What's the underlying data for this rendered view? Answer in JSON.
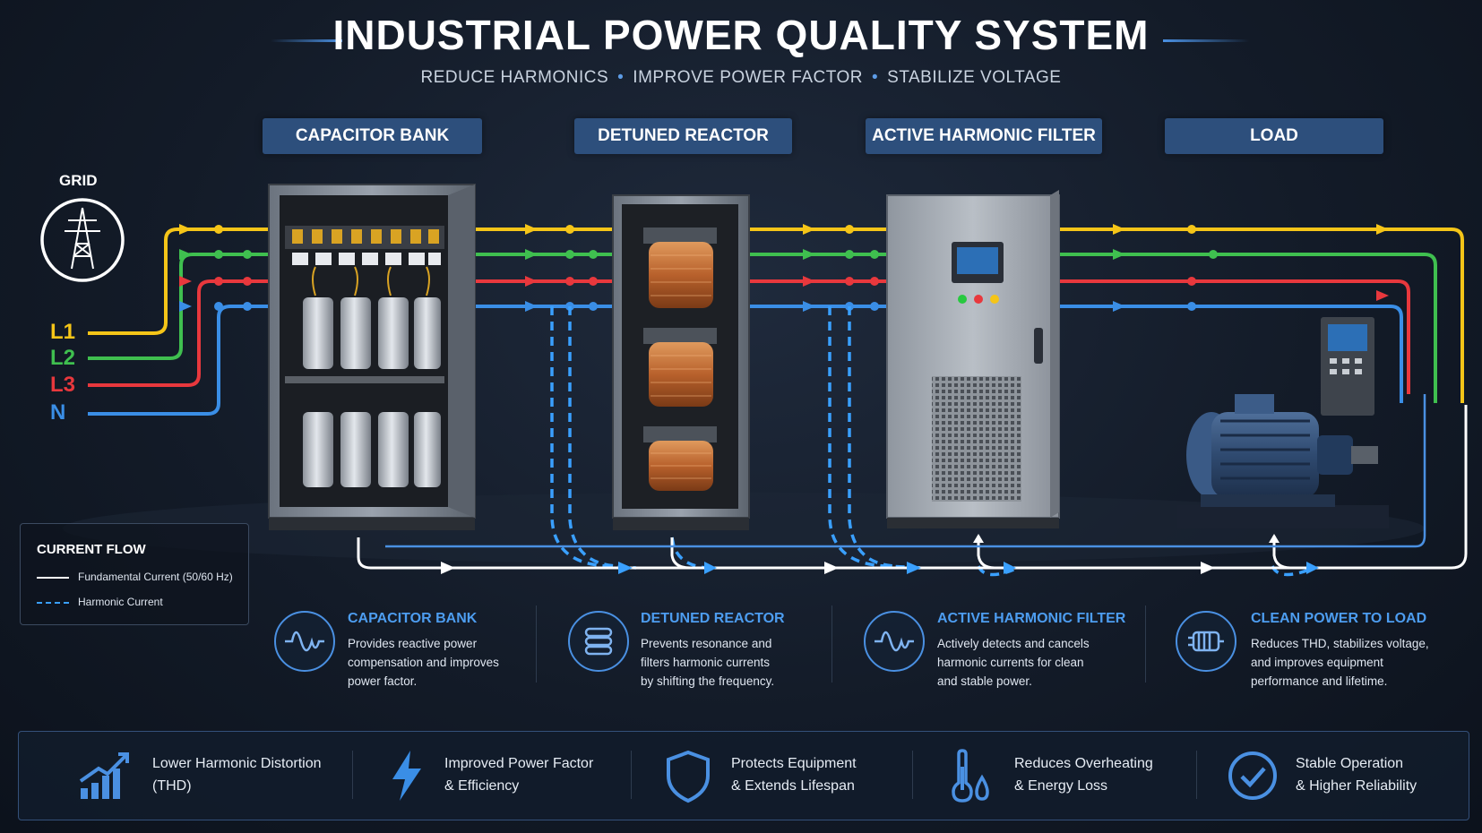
{
  "header": {
    "title": "INDUSTRIAL POWER QUALITY SYSTEM",
    "subtitle_parts": [
      "REDUCE HARMONICS",
      "IMPROVE POWER FACTOR",
      "STABILIZE VOLTAGE"
    ],
    "subtitle_separator": "•"
  },
  "stages": {
    "capacitor_bank": "CAPACITOR BANK",
    "detuned_reactor": "DETUNED REACTOR",
    "active_harmonic_filter": "ACTIVE HARMONIC FILTER",
    "load": "LOAD"
  },
  "grid": {
    "label": "GRID",
    "icon": "transmission-tower-icon",
    "phases": [
      {
        "label": "L1",
        "color": "#f5c518"
      },
      {
        "label": "L2",
        "color": "#3fbf4f"
      },
      {
        "label": "L3",
        "color": "#e8383d"
      },
      {
        "label": "N",
        "color": "#3a8ee6"
      }
    ]
  },
  "legend": {
    "title": "CURRENT FLOW",
    "items": [
      {
        "label": "Fundamental Current (50/60 Hz)",
        "style": "solid",
        "color": "#ffffff"
      },
      {
        "label": "Harmonic Current",
        "style": "dashed",
        "color": "#3aa0ff"
      }
    ]
  },
  "info": [
    {
      "icon": "sine-wave-icon",
      "title": "CAPACITOR BANK",
      "lines": [
        "Provides reactive power",
        "compensation and improves",
        "power factor."
      ]
    },
    {
      "icon": "coil-icon",
      "title": "DETUNED REACTOR",
      "lines": [
        "Prevents resonance and",
        "filters harmonic currents",
        "by shifting the frequency."
      ]
    },
    {
      "icon": "sine-wave-icon",
      "title": "ACTIVE HARMONIC FILTER",
      "lines": [
        "Actively detects and cancels",
        "harmonic currents for clean",
        "and stable power."
      ]
    },
    {
      "icon": "motor-icon",
      "title": "CLEAN POWER TO LOAD",
      "lines": [
        "Reduces THD, stabilizes voltage,",
        "and improves equipment",
        "performance and lifetime."
      ]
    }
  ],
  "benefits": [
    {
      "icon": "bar-chart-icon",
      "lines": [
        "Lower Harmonic Distortion",
        "(THD)"
      ]
    },
    {
      "icon": "lightning-icon",
      "lines": [
        "Improved Power Factor",
        "& Efficiency"
      ]
    },
    {
      "icon": "shield-icon",
      "lines": [
        "Protects Equipment",
        "& Extends Lifespan"
      ]
    },
    {
      "icon": "thermometer-icon",
      "lines": [
        "Reduces Overheating",
        "& Energy Loss"
      ]
    },
    {
      "icon": "checkmark-icon",
      "lines": [
        "Stable Operation",
        "& Higher Reliability"
      ]
    }
  ],
  "colors": {
    "accent": "#4a90e2",
    "stage_label_bg": "#2d4f7c",
    "harmonic": "#3aa0ff",
    "fundamental": "#ffffff"
  }
}
